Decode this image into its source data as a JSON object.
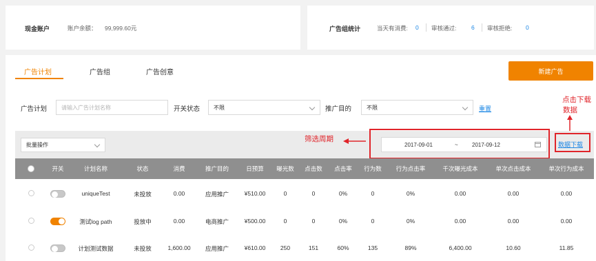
{
  "account": {
    "title": "现金账户",
    "balance_label": "账户余额：",
    "balance_value": "99,999.60元"
  },
  "stats": {
    "title": "广告组统计",
    "items": [
      {
        "label": "当天有消费:",
        "value": "0"
      },
      {
        "label": "审核通过:",
        "value": "6"
      },
      {
        "label": "审核拒绝:",
        "value": "0"
      }
    ]
  },
  "tabs": [
    {
      "label": "广告计划",
      "active": true
    },
    {
      "label": "广告组",
      "active": false
    },
    {
      "label": "广告创意",
      "active": false
    }
  ],
  "new_button_label": "新建广告",
  "filters": {
    "plan_label": "广告计划",
    "plan_placeholder": "请输入广告计划名称",
    "switch_label": "开关状态",
    "switch_value": "不限",
    "purpose_label": "推广目的",
    "purpose_value": "不限",
    "reset_label": "重置"
  },
  "toolbar": {
    "batch_label": "批量操作",
    "date_start": "2017-09-01",
    "date_separator": "~",
    "date_end": "2017-09-12",
    "download_label": "数据下载"
  },
  "annotations": {
    "click_download": "点击下载",
    "data_word": "数据",
    "filter_period": "筛选周期"
  },
  "table": {
    "columns": [
      "开关",
      "计划名称",
      "状态",
      "消费",
      "推广目的",
      "日预算",
      "曝光数",
      "点击数",
      "点击率",
      "行为数",
      "行为点击率",
      "千次曝光成本",
      "单次点击成本",
      "单次行为成本"
    ],
    "rows": [
      {
        "switch_on": false,
        "cells": [
          "uniqueTest",
          "未投放",
          "0.00",
          "应用推广",
          "¥510.00",
          "0",
          "0",
          "0%",
          "0",
          "0%",
          "0.00",
          "0.00",
          "0.00"
        ]
      },
      {
        "switch_on": true,
        "cells": [
          "测试log path",
          "投放中",
          "0.00",
          "电商推广",
          "¥500.00",
          "0",
          "0",
          "0%",
          "0",
          "0%",
          "0.00",
          "0.00",
          "0.00"
        ]
      },
      {
        "switch_on": false,
        "cells": [
          "计划测试数据",
          "未投放",
          "1,600.00",
          "应用推广",
          "¥610.00",
          "250",
          "151",
          "60%",
          "135",
          "89%",
          "6,400.00",
          "10.60",
          "11.85"
        ]
      }
    ]
  },
  "colors": {
    "accent": "#f08300",
    "link": "#1e88e5",
    "annotation": "#e0242a",
    "header_bg": "#8f8f8f"
  }
}
